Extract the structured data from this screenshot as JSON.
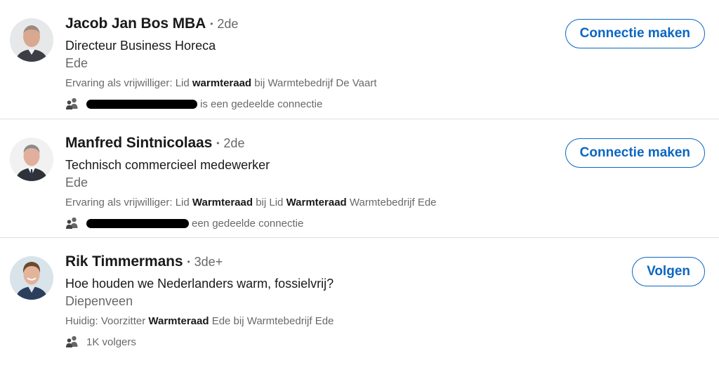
{
  "results": [
    {
      "name": "Jacob Jan Bos MBA",
      "degree": "2de",
      "headline": "Directeur Business Horeca",
      "location": "Ede",
      "snippet": {
        "pre": "Ervaring als vrijwilliger: Lid ",
        "b1": "warmteraad",
        "mid": " bij Warmtebedrijf De Vaart",
        "b2": "",
        "post": ""
      },
      "insight": "is een gedeelde connectie",
      "action": "Connectie maken"
    },
    {
      "name": "Manfred Sintnicolaas",
      "degree": "2de",
      "headline": "Technisch commercieel medewerker",
      "location": "Ede",
      "snippet": {
        "pre": "Ervaring als vrijwilliger: Lid ",
        "b1": "Warmteraad",
        "mid": " bij Lid ",
        "b2": "Warmteraad",
        "post": " Warmtebedrijf Ede"
      },
      "insight": "een gedeelde connectie",
      "action": "Connectie maken"
    },
    {
      "name": "Rik Timmermans",
      "degree": "3de+",
      "headline": "Hoe houden we Nederlanders warm, fossielvrij?",
      "location": "Diepenveen",
      "snippet": {
        "pre": "Huidig: Voorzitter ",
        "b1": "Warmteraad",
        "mid": " Ede bij Warmtebedrijf Ede",
        "b2": "",
        "post": ""
      },
      "insight": "1K volgers",
      "action": "Volgen"
    }
  ],
  "icons": {
    "insight": "people-icon"
  },
  "colors": {
    "accent": "#0a66c2",
    "divider": "#e0dfdc",
    "muted": "rgba(0,0,0,0.6)"
  }
}
